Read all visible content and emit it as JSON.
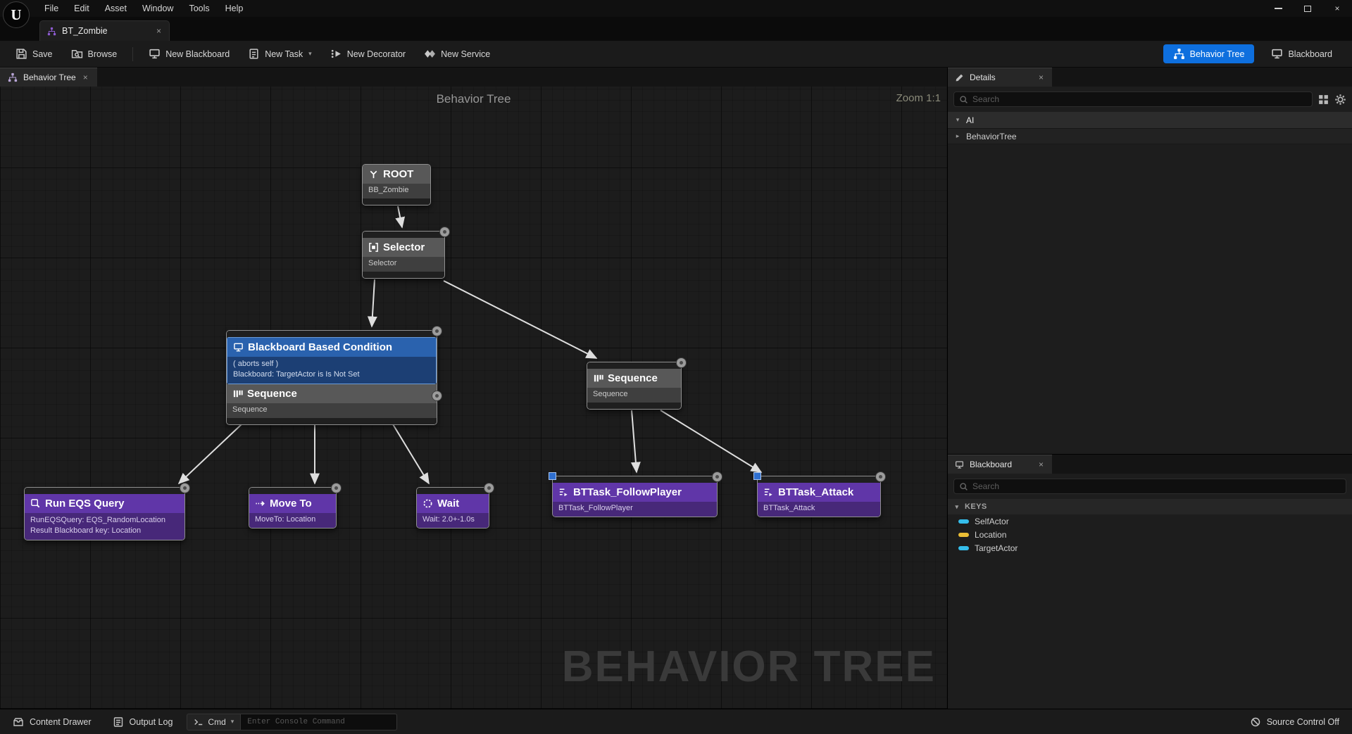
{
  "icons": {
    "close": "×",
    "chevron_down": "▾",
    "expand_down": "▾",
    "expand_right": "▸",
    "logo": "U"
  },
  "menubar": {
    "items": [
      "File",
      "Edit",
      "Asset",
      "Window",
      "Tools",
      "Help"
    ]
  },
  "tabs": {
    "asset_tab": "BT_Zombie"
  },
  "toolbar": {
    "save": "Save",
    "browse": "Browse",
    "new_blackboard": "New Blackboard",
    "new_task": "New Task",
    "new_decorator": "New Decorator",
    "new_service": "New Service",
    "mode_behavior_tree": "Behavior Tree",
    "mode_blackboard": "Blackboard",
    "accent_color": "#0e6fde"
  },
  "graph": {
    "tab": "Behavior Tree",
    "heading": "Behavior Tree",
    "zoom": "Zoom 1:1",
    "watermark": "BEHAVIOR TREE",
    "nodes": {
      "root": {
        "title": "ROOT",
        "subtitle": "BB_Zombie"
      },
      "selector": {
        "title": "Selector",
        "subtitle": "Selector"
      },
      "decorator": {
        "title": "Blackboard Based Condition",
        "line1": "( aborts self )",
        "line2": "Blackboard: TargetActor is Is Not Set"
      },
      "decorated_sequence": {
        "title": "Sequence",
        "subtitle": "Sequence"
      },
      "sequence": {
        "title": "Sequence",
        "subtitle": "Sequence"
      },
      "run_eqs_query": {
        "title": "Run EQS Query",
        "line1": "RunEQSQuery: EQS_RandomLocation",
        "line2": "Result Blackboard key: Location"
      },
      "move_to": {
        "title": "Move To",
        "subtitle": "MoveTo: Location"
      },
      "wait": {
        "title": "Wait",
        "subtitle": "Wait: 2.0+-1.0s"
      },
      "follow_player": {
        "title": "BTTask_FollowPlayer",
        "subtitle": "BTTask_FollowPlayer"
      },
      "attack": {
        "title": "BTTask_Attack",
        "subtitle": "BTTask_Attack"
      }
    }
  },
  "details": {
    "tab": "Details",
    "search_placeholder": "Search",
    "category_ai": "AI",
    "row_behavior_tree": "BehaviorTree"
  },
  "blackboard_panel": {
    "tab": "Blackboard",
    "search_placeholder": "Search",
    "section": "KEYS",
    "keys": [
      {
        "name": "SelfActor",
        "color": "#35bdea"
      },
      {
        "name": "Location",
        "color": "#eabd35"
      },
      {
        "name": "TargetActor",
        "color": "#35bdea"
      }
    ]
  },
  "statusbar": {
    "content_drawer": "Content Drawer",
    "output_log": "Output Log",
    "cmd": "Cmd",
    "console_placeholder": "Enter Console Command",
    "source_control": "Source Control Off"
  }
}
